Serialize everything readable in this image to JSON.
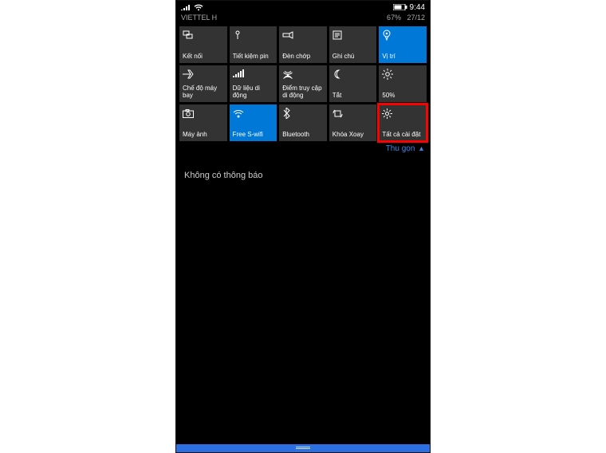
{
  "status": {
    "carrier": "VIETTEL H",
    "battery_pct": "67%",
    "date": "27/12",
    "time": "9:44"
  },
  "quick_actions": [
    {
      "icon": "connect-icon",
      "label": "Kết nối",
      "active": false
    },
    {
      "icon": "leaf-icon",
      "label": "Tiết kiệm pin",
      "active": false
    },
    {
      "icon": "flashlight-icon",
      "label": "Đèn chớp",
      "active": false
    },
    {
      "icon": "note-icon",
      "label": "Ghi chú",
      "active": false
    },
    {
      "icon": "location-icon",
      "label": "Vị trí",
      "active": true
    },
    {
      "icon": "airplane-icon",
      "label": "Chế độ máy bay",
      "active": false
    },
    {
      "icon": "cellular-icon",
      "label": "Dữ liệu di động",
      "active": false
    },
    {
      "icon": "hotspot-icon",
      "label": "Điểm truy cập di động",
      "active": false
    },
    {
      "icon": "moon-icon",
      "label": "Tắt",
      "active": false
    },
    {
      "icon": "brightness-icon",
      "label": "50%",
      "active": false
    },
    {
      "icon": "camera-icon",
      "label": "Máy ảnh",
      "active": false
    },
    {
      "icon": "wifi-icon",
      "label": "Free S-wifi",
      "active": true
    },
    {
      "icon": "bluetooth-icon",
      "label": "Bluetooth",
      "active": false
    },
    {
      "icon": "rotation-icon",
      "label": "Khóa Xoay",
      "active": false
    },
    {
      "icon": "settings-icon",
      "label": "Tất cả cài đặt",
      "active": false,
      "highlight": true
    }
  ],
  "collapse_label": "Thu gọn",
  "notifications": {
    "empty_text": "Không có thông báo"
  }
}
